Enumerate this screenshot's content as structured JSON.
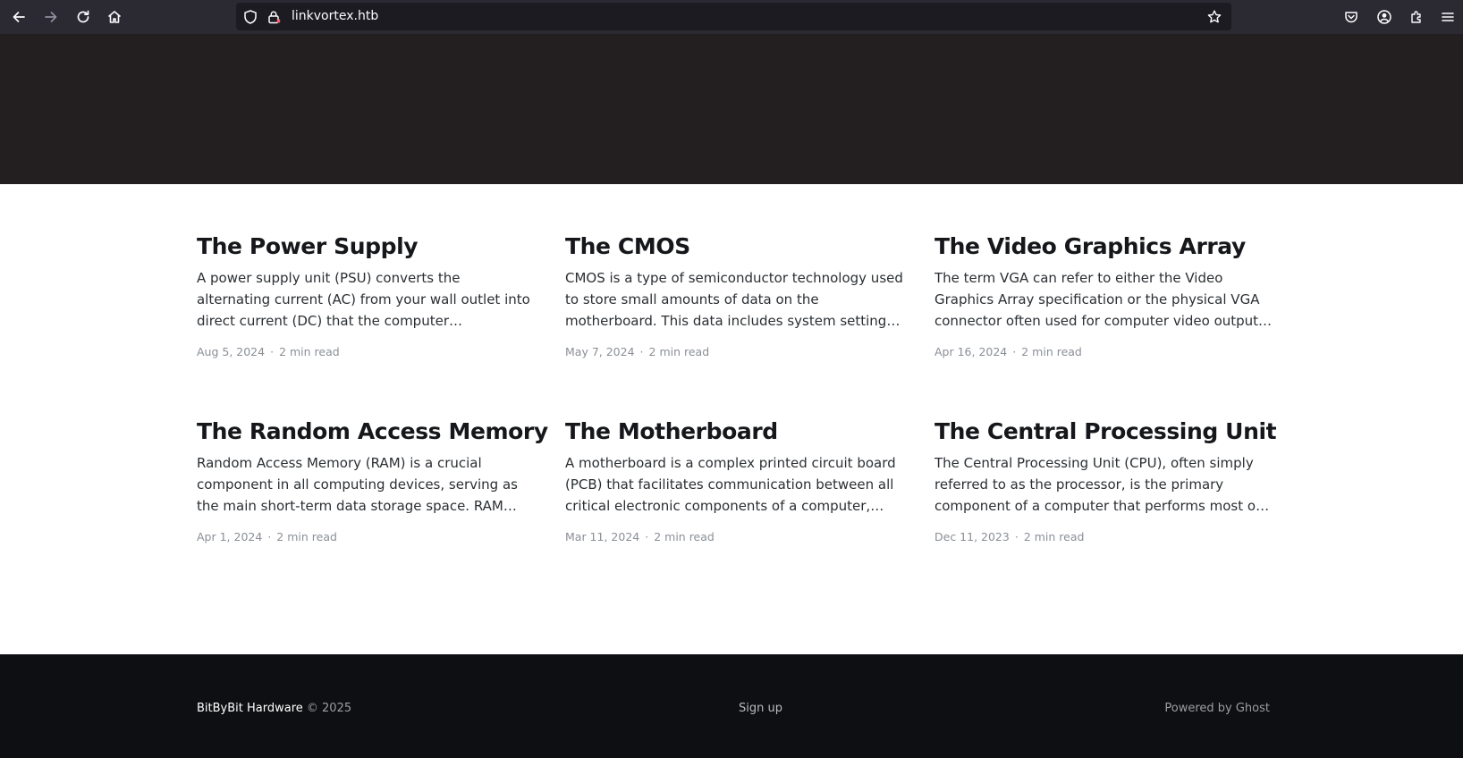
{
  "browser": {
    "url": "linkvortex.htb",
    "icons": [
      "back-icon",
      "forward-icon",
      "reload-icon",
      "home-icon",
      "shield-icon",
      "lock-icon",
      "bookmark-star-icon",
      "pocket-icon",
      "account-icon",
      "extensions-icon",
      "menu-icon"
    ]
  },
  "posts": [
    {
      "title": "The Power Supply",
      "excerpt": "A power supply unit (PSU) converts the alternating current (AC) from your wall outlet into direct current (DC) that the computer components require. It…",
      "date": "Aug 5, 2024",
      "read_time": "2 min read"
    },
    {
      "title": "The CMOS",
      "excerpt": "CMOS is a type of semiconductor technology used to store small amounts of data on the motherboard. This data includes system settings and configurati…",
      "date": "May 7, 2024",
      "read_time": "2 min read"
    },
    {
      "title": "The Video Graphics Array",
      "excerpt": "The term VGA can refer to either the Video Graphics Array specification or the physical VGA connector often used for computer video output. Below, I'll…",
      "date": "Apr 16, 2024",
      "read_time": "2 min read"
    },
    {
      "title": "The Random Access Memory",
      "excerpt": "Random Access Memory (RAM) is a crucial component in all computing devices, serving as the main short-term data storage space. RAM stores t…",
      "date": "Apr 1, 2024",
      "read_time": "2 min read"
    },
    {
      "title": "The Motherboard",
      "excerpt": "A motherboard is a complex printed circuit board (PCB) that facilitates communication between all critical electronic components of a computer,…",
      "date": "Mar 11, 2024",
      "read_time": "2 min read"
    },
    {
      "title": "The Central Processing Unit",
      "excerpt": "The Central Processing Unit (CPU), often simply referred to as the processor, is the primary component of a computer that performs most of t…",
      "date": "Dec 11, 2023",
      "read_time": "2 min read"
    }
  ],
  "meta_separator": "·",
  "footer": {
    "brand": "BitByBit Hardware",
    "copyright": "© 2025",
    "signup": "Sign up",
    "powered_by": "Powered by Ghost"
  },
  "colors": {
    "header_bg": "#231f20",
    "footer_bg": "#0e0f12",
    "toolbar_bg": "#2b2a33"
  }
}
